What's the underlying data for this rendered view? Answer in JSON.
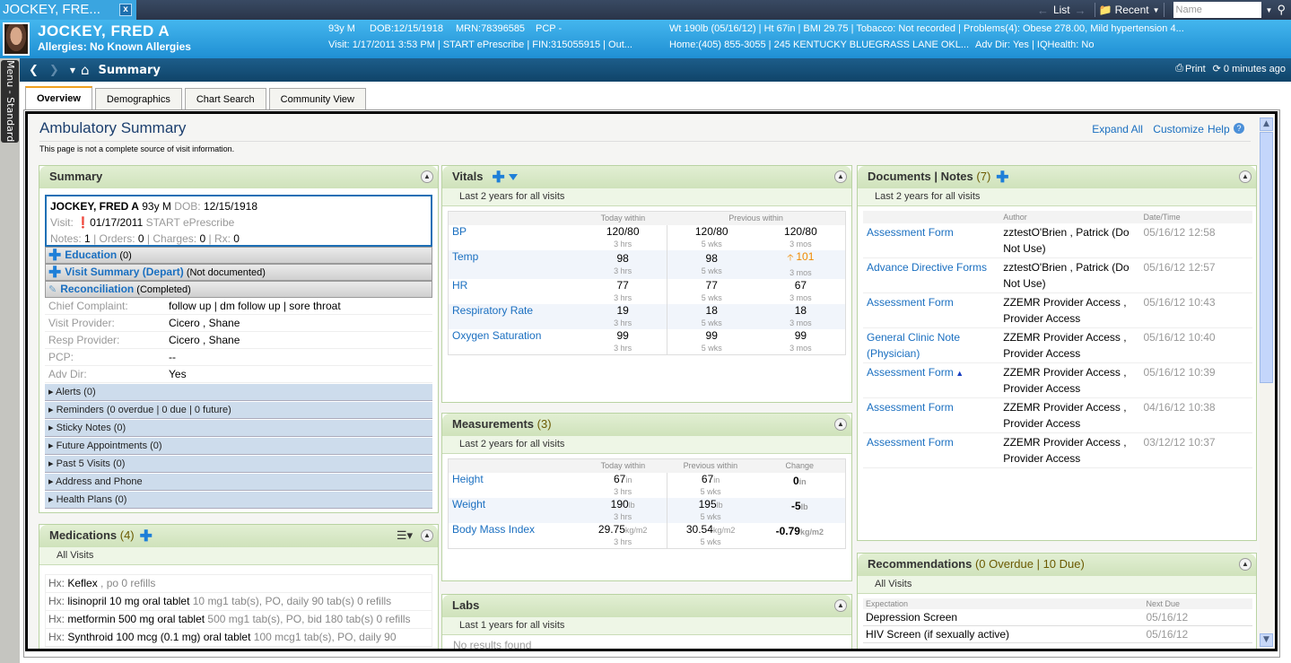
{
  "topbar": {
    "patient_tab": "JOCKEY, FRE...",
    "close_label": "x",
    "list_label": "List",
    "recent_label": "Recent",
    "name_placeholder": "Name"
  },
  "banner": {
    "name": "JOCKEY, FRED A",
    "allergies": "Allergies: No Known Allergies",
    "age_sex": "93y  M",
    "dob": "DOB:12/15/1918",
    "mrn": "MRN:78396585",
    "pcp": "PCP -",
    "visit": "Visit: 1/17/2011 3:53 PM  |  START ePrescribe  |  FIN:315055915  |  Out...",
    "wt": "Wt 190lb (05/16/12)   |   Ht 67in   |   BMI 29.75   |   Tobacco: Not recorded   |   Problems(4):  Obese 278.00, Mild hypertension 4...",
    "home": "Home:(405) 855-3055   |   245 KENTUCKY BLUEGRASS LANE OKL...",
    "adv": "Adv Dir: Yes   |   IQHealth: No"
  },
  "nav": {
    "title": "Summary",
    "print": "Print",
    "refresh": "0 minutes ago"
  },
  "sidemenu": "Menu - Standard",
  "tabs": [
    "Overview",
    "Demographics",
    "Chart Search",
    "Community View"
  ],
  "page": {
    "title": "Ambulatory Summary",
    "disclaimer": "This page is not a complete source of visit information.",
    "expand_all": "Expand All",
    "customize": "Customize",
    "help": "Help"
  },
  "summary": {
    "title": "Summary",
    "patient_name": "JOCKEY, FRED A",
    "age_sex": "93y M",
    "dob_label": "DOB:",
    "dob": "12/15/1918",
    "visit_label": "Visit:",
    "visit_date": "01/17/2011",
    "visit_type": "START ePrescribe",
    "notes_label": "Notes:",
    "notes": "1",
    "orders_label": "Orders:",
    "orders": "0",
    "charges_label": "Charges:",
    "charges": "0",
    "rx_label": "Rx:",
    "rx": "0",
    "education": "Education",
    "education_count": "(0)",
    "visit_summary": "Visit Summary (Depart)",
    "visit_summary_status": "(Not documented)",
    "reconciliation": "Reconciliation",
    "reconciliation_status": "(Completed)",
    "fields": [
      {
        "k": "Chief Complaint:",
        "v": "follow up | dm follow up | sore throat"
      },
      {
        "k": "Visit Provider:",
        "v": "Cicero , Shane"
      },
      {
        "k": "Resp Provider:",
        "v": "Cicero , Shane"
      },
      {
        "k": "PCP:",
        "v": "--"
      },
      {
        "k": "Adv Dir:",
        "v": "Yes"
      }
    ],
    "sections": [
      "Alerts (0)",
      "Reminders (0 overdue | 0 due | 0 future)",
      "Sticky Notes (0)",
      "Future Appointments (0)",
      "Past 5 Visits (0)",
      "Address and Phone",
      "Health Plans (0)"
    ]
  },
  "medications": {
    "title": "Medications",
    "count": "(4)",
    "subtitle": "All Visits",
    "items": [
      {
        "hx": "Hx:",
        "name": "Keflex",
        "sig": " , po  0 refills"
      },
      {
        "hx": "Hx:",
        "name": "lisinopril 10 mg oral tablet",
        "sig": "  10 mg1 tab(s), PO, daily  90 tab(s) 0 refills"
      },
      {
        "hx": "Hx:",
        "name": "metformin 500 mg oral tablet",
        "sig": "  500 mg1 tab(s), PO, bid  180 tab(s) 0 refills"
      },
      {
        "hx": "Hx:",
        "name": "Synthroid 100 mcg (0.1 mg) oral tablet",
        "sig": "  100 mcg1 tab(s), PO, daily  90"
      }
    ]
  },
  "vitals": {
    "title": "Vitals",
    "subtitle": "Last 2 years for all visits",
    "col_today": "Today within",
    "col_prev": "Previous within",
    "rows": [
      {
        "name": "BP",
        "v1": "120/80",
        "t1": "3 hrs",
        "v2": "120/80",
        "t2": "5 wks",
        "v3": "120/80",
        "t3": "3 mos"
      },
      {
        "name": "Temp",
        "v1": "98",
        "t1": "3 hrs",
        "v2": "98",
        "t2": "5 wks",
        "v3": "101",
        "t3": "3 mos",
        "flag": "high"
      },
      {
        "name": "HR",
        "v1": "77",
        "t1": "3 hrs",
        "v2": "77",
        "t2": "5 wks",
        "v3": "67",
        "t3": "3 mos"
      },
      {
        "name": "Respiratory Rate",
        "v1": "19",
        "t1": "3 hrs",
        "v2": "18",
        "t2": "5 wks",
        "v3": "18",
        "t3": "3 mos"
      },
      {
        "name": "Oxygen Saturation",
        "v1": "99",
        "t1": "3 hrs",
        "v2": "99",
        "t2": "5 wks",
        "v3": "99",
        "t3": "3 mos"
      }
    ],
    "high_color": "#f08a00"
  },
  "measurements": {
    "title": "Measurements",
    "count": "(3)",
    "subtitle": "Last 2 years for all visits",
    "col_today": "Today within",
    "col_prev": "Previous within",
    "col_change": "Change",
    "rows": [
      {
        "name": "Height",
        "v1": "67",
        "u": "in",
        "t1": "3 hrs",
        "v2": "67",
        "t2": "5 wks",
        "chg": "0"
      },
      {
        "name": "Weight",
        "v1": "190",
        "u": "lb",
        "t1": "3 hrs",
        "v2": "195",
        "t2": "5 wks",
        "chg": "-5"
      },
      {
        "name": "Body Mass Index",
        "v1": "29.75",
        "u": "kg/m2",
        "t1": "3 hrs",
        "v2": "30.54",
        "t2": "5 wks",
        "chg": "-0.79"
      }
    ]
  },
  "labs": {
    "title": "Labs",
    "subtitle": "Last 1 years for all visits",
    "empty": "No results found"
  },
  "documents": {
    "title": "Documents | Notes",
    "count": "(7)",
    "subtitle": "Last 2 years for all visits",
    "col_author": "Author",
    "col_date": "Date/Time",
    "rows": [
      {
        "name": "Assessment Form",
        "author": "zztestO'Brien , Patrick (Do Not Use)",
        "date": "05/16/12 12:58"
      },
      {
        "name": "Advance Directive Forms",
        "author": "zztestO'Brien , Patrick (Do Not Use)",
        "date": "05/16/12 12:57"
      },
      {
        "name": "Assessment Form",
        "author": "ZZEMR Provider Access , Provider Access",
        "date": "05/16/12 10:43"
      },
      {
        "name": "General Clinic Note (Physician)",
        "author": "ZZEMR Provider Access , Provider Access",
        "date": "05/16/12 10:40"
      },
      {
        "name": "Assessment Form",
        "author": "ZZEMR Provider Access , Provider Access",
        "date": "05/16/12 10:39",
        "marker": true
      },
      {
        "name": "Assessment Form",
        "author": "ZZEMR Provider Access , Provider Access",
        "date": "04/16/12 10:38"
      },
      {
        "name": "Assessment Form",
        "author": "ZZEMR Provider Access , Provider Access",
        "date": "03/12/12 10:37"
      }
    ]
  },
  "recommendations": {
    "title": "Recommendations",
    "count": "(0 Overdue | 10 Due)",
    "subtitle": "All Visits",
    "col_exp": "Expectation",
    "col_due": "Next Due",
    "rows": [
      {
        "name": "Depression Screen",
        "due": "05/16/12"
      },
      {
        "name": "HIV Screen (if sexually active)",
        "due": "05/16/12"
      }
    ]
  }
}
